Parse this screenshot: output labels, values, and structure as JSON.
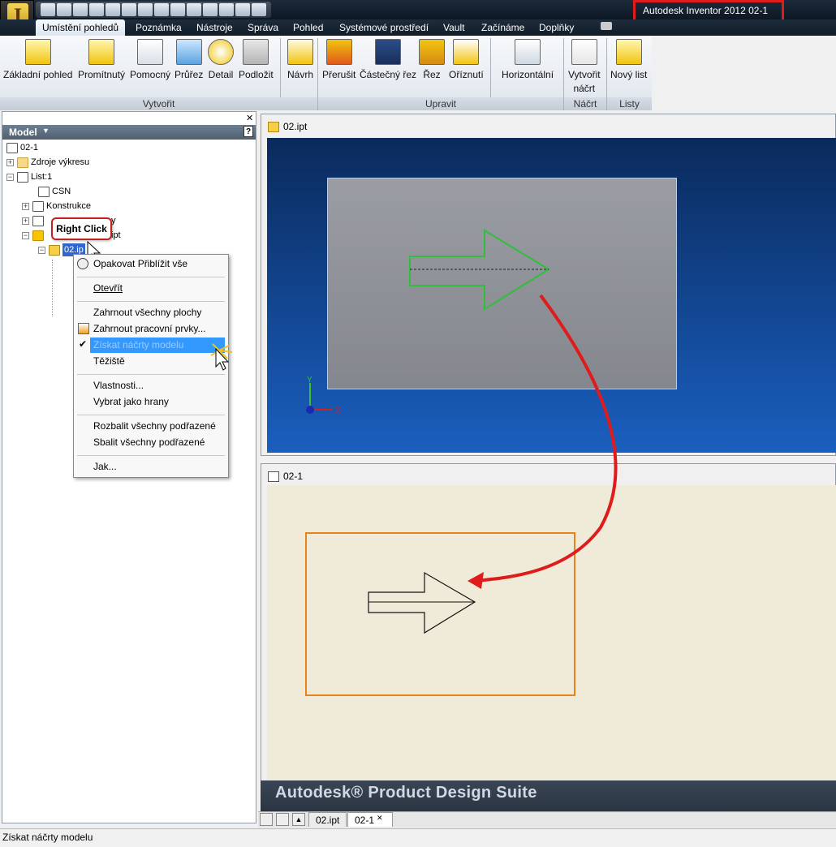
{
  "app": {
    "title": "Autodesk Inventor 2012    02-1"
  },
  "tabs": [
    "Umístění pohledů",
    "Poznámka",
    "Nástroje",
    "Správa",
    "Pohled",
    "Systémové prostředí",
    "Vault",
    "Začínáme",
    "Doplňky"
  ],
  "ribbon": {
    "buttons": {
      "zakladni": "Základní pohled",
      "promitnuty": "Promítnutý",
      "pomocny": "Pomocný",
      "prurez": "Průřez",
      "detail": "Detail",
      "podlozit": "Podložit",
      "navrh": "Návrh",
      "prerusit": "Přerušit",
      "castecny": "Částečný řez",
      "rez": "Řez",
      "oriznuti": "Oříznutí",
      "horizontalni": "Horizontální",
      "vytvorit_nacrt_1": "Vytvořit",
      "vytvorit_nacrt_2": "náčrt",
      "novy_list": "Nový list"
    },
    "groups": {
      "vytvorit": "Vytvořit",
      "upravit": "Upravit",
      "nacrt": "Náčrt",
      "listy": "Listy"
    }
  },
  "browser": {
    "header": "Model",
    "items": [
      "02-1",
      "Zdroje výkresu",
      "List:1",
      "CSN",
      "Konstrukce",
      "y",
      "ipt",
      "02.ip"
    ]
  },
  "callout": "Right Click",
  "context_menu": {
    "items": [
      "Opakovat Přiblížit vše",
      "Otevřít",
      "Zahrnout všechny plochy",
      "Zahrnout pracovní prvky...",
      "Získat náčrty modelu",
      "Těžiště",
      "Vlastnosti...",
      "Vybrat jako hrany",
      "Rozbalit všechny podřazené",
      "Sbalit všechny podřazené",
      "Jak..."
    ]
  },
  "windows": {
    "part": "02.ipt",
    "drawing": "02-1"
  },
  "axes": {
    "y": "Y",
    "x": "X"
  },
  "suite": "Autodesk® Product Design Suite",
  "doc_tabs": [
    "02.ipt",
    "02-1"
  ],
  "status": "Získat náčrty modelu",
  "colors": {
    "accent_red": "#e01b1b",
    "highlight": "#3399ff",
    "green_arrow": "#2fbf3a",
    "orange_frame": "#e8821a"
  }
}
